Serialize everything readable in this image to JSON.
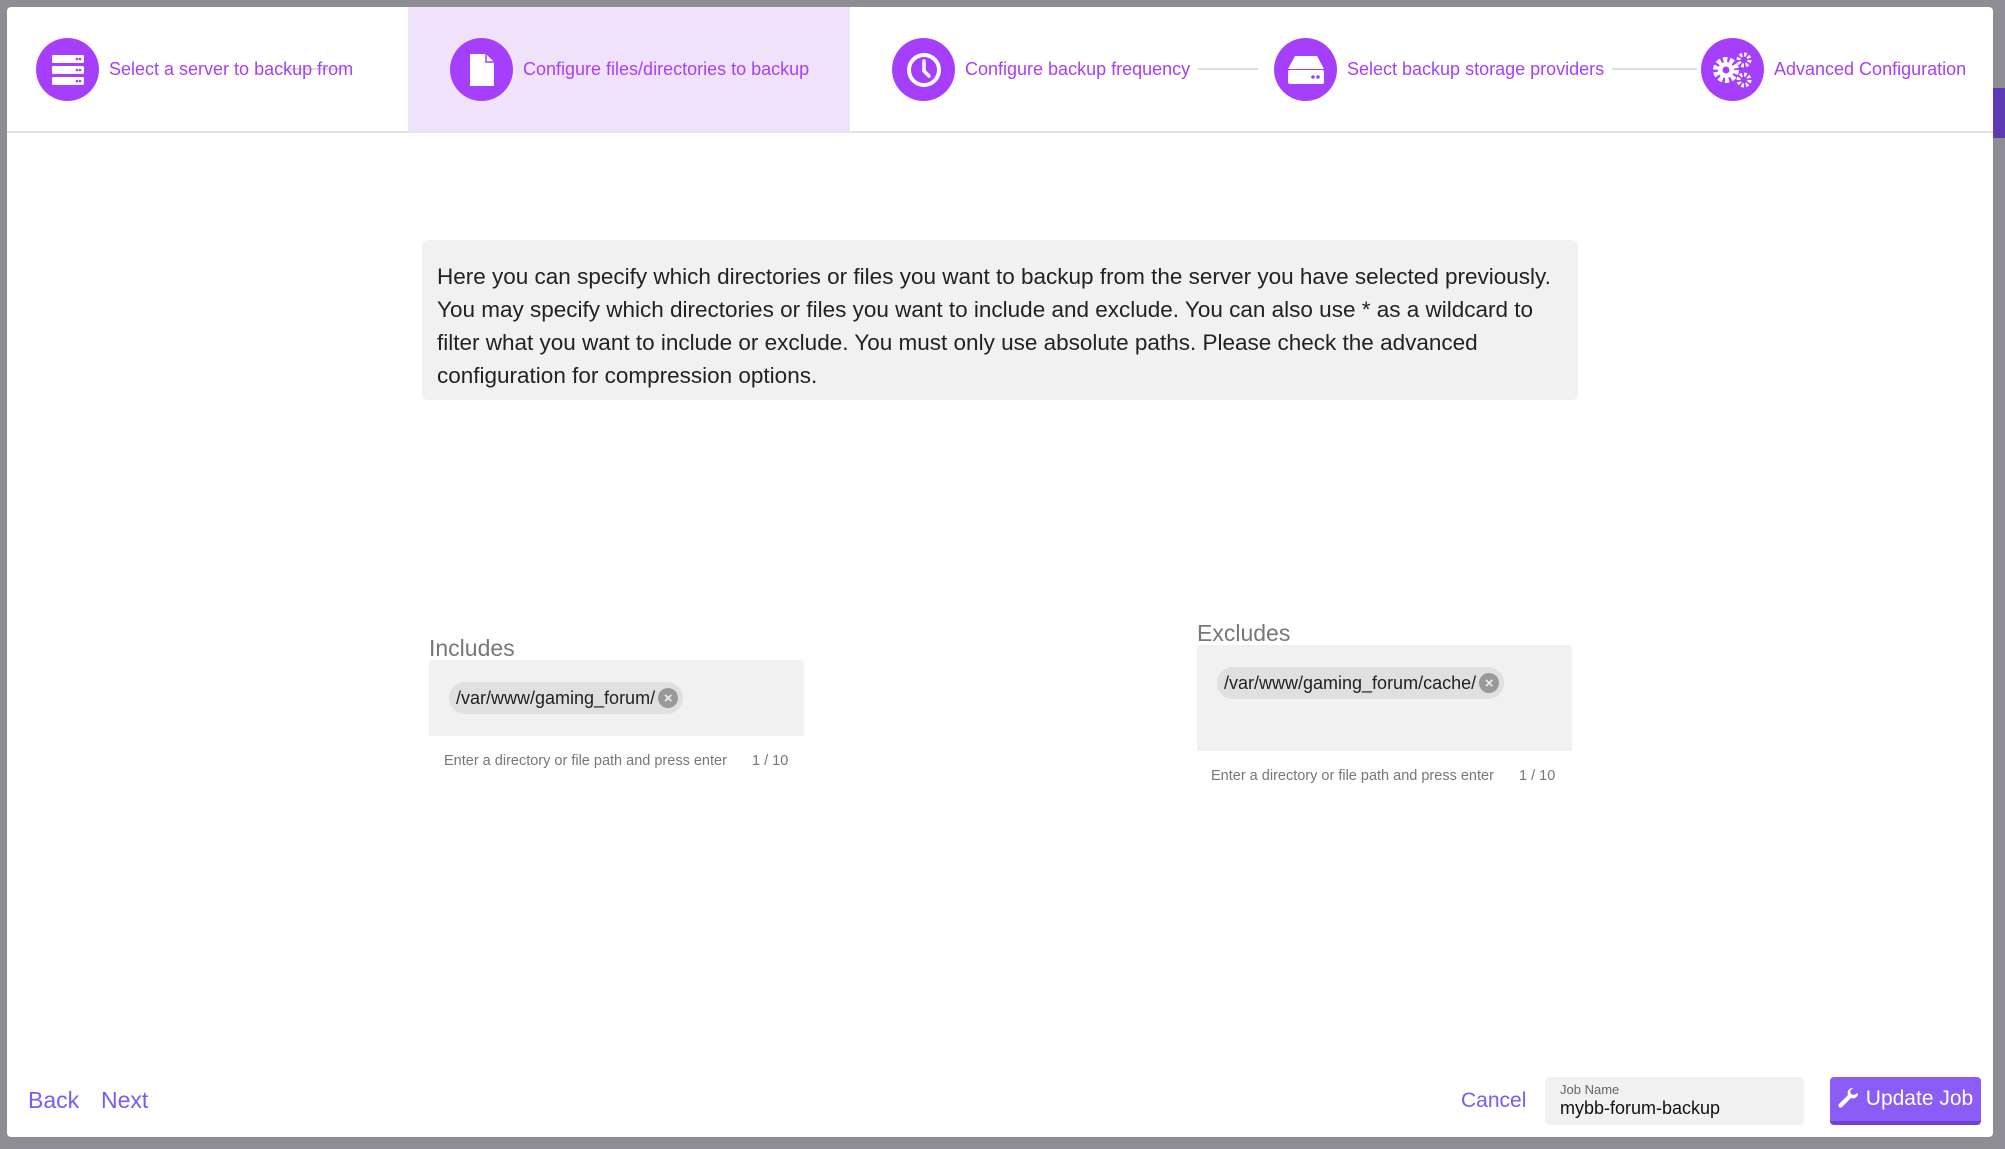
{
  "steps": [
    {
      "label": "Select a server to backup from",
      "icon": "server-icon"
    },
    {
      "label": "Configure files/directories to backup",
      "icon": "file-icon",
      "active": true
    },
    {
      "label": "Configure backup frequency",
      "icon": "clock-icon"
    },
    {
      "label": "Select backup storage providers",
      "icon": "hard-drive-icon"
    },
    {
      "label": "Advanced Configuration",
      "icon": "gears-icon"
    }
  ],
  "description": "Here you can specify which directories or files you want to backup from the server you have selected previously. You may specify which directories or files you want to include and exclude. You can also use * as a wildcard to filter what you want to include or exclude. You must only use absolute paths. Please check the advanced configuration for compression options.",
  "includes": {
    "label": "Includes",
    "chips": [
      "/var/www/gaming_forum/"
    ],
    "hint": "Enter a directory or file path and press enter",
    "count": "1 / 10"
  },
  "excludes": {
    "label": "Excludes",
    "chips": [
      "/var/www/gaming_forum/cache/"
    ],
    "hint": "Enter a directory or file path and press enter",
    "count": "1 / 10"
  },
  "footer": {
    "back": "Back",
    "next": "Next",
    "cancel": "Cancel",
    "job_name_label": "Job Name",
    "job_name_value": "mybb-forum-backup",
    "update": "Update Job"
  },
  "colors": {
    "accent": "#a63ffb",
    "button": "#8b5cf6",
    "active_step_bg": "#f0e2fb"
  }
}
